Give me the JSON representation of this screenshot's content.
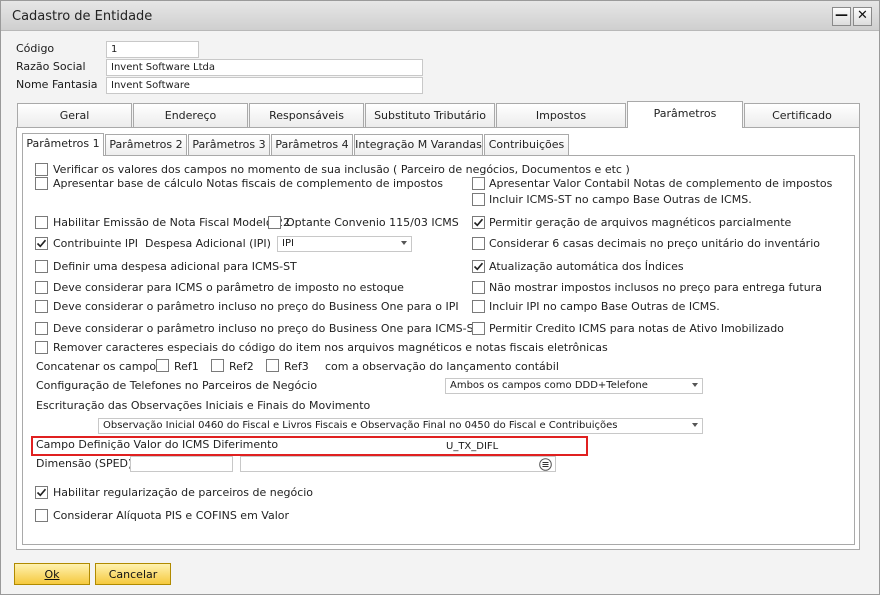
{
  "window": {
    "title": "Cadastro de Entidade",
    "minimize": "—",
    "close": "✕"
  },
  "header": {
    "codigo_label": "Código",
    "codigo_value": "1",
    "razao_label": "Razão Social",
    "razao_value": "Invent Software Ltda",
    "fantasia_label": "Nome Fantasia",
    "fantasia_value": "Invent Software"
  },
  "tabs": [
    "Geral",
    "Endereço",
    "Responsáveis",
    "Substituto Tributário",
    "Impostos",
    "Parâmetros",
    "Certificado"
  ],
  "active_tab": "Parâmetros",
  "subtabs": [
    "Parâmetros 1",
    "Parâmetros 2",
    "Parâmetros 3",
    "Parâmetros 4",
    "Integração M Varandas",
    "Contribuições"
  ],
  "active_subtab": "Parâmetros 1",
  "options": {
    "verificar": {
      "label": "Verificar os valores dos campos no momento de sua inclusão ( Parceiro de negócios, Documentos e etc )",
      "checked": false
    },
    "apresentar_base": {
      "label": "Apresentar base de cálculo Notas fiscais de complemento de impostos",
      "checked": false
    },
    "apresentar_valor": {
      "label": "Apresentar Valor Contabil Notas de complemento de impostos",
      "checked": false
    },
    "incluir_icms_st": {
      "label": "Incluir ICMS-ST no campo Base Outras de ICMS.",
      "checked": false
    },
    "habilitar_nf22": {
      "label": "Habilitar Emissão de Nota Fiscal Modelo 22",
      "checked": false
    },
    "optante": {
      "label": "Optante Convenio 115/03 ICMS",
      "checked": false
    },
    "permitir_magneticos": {
      "label": "Permitir geração de arquivos magnéticos parcialmente",
      "checked": true
    },
    "contribuinte_ipi": {
      "label": "Contribuinte IPI",
      "checked": true
    },
    "despesa_label": "Despesa Adicional (IPI)",
    "despesa_value": "IPI",
    "considerar_6casas": {
      "label": "Considerar 6 casas decimais no preço unitário do inventário",
      "checked": false
    },
    "definir_despesa": {
      "label": "Definir uma despesa adicional para ICMS-ST",
      "checked": false
    },
    "atualizacao_indices": {
      "label": "Atualização automática dos Índices",
      "checked": true
    },
    "icms_estoque": {
      "label": "Deve considerar para ICMS o parâmetro de imposto no estoque",
      "checked": false
    },
    "nao_mostrar": {
      "label": "Não mostrar impostos inclusos no preço para entrega futura",
      "checked": false
    },
    "param_ipi": {
      "label": "Deve considerar o parâmetro incluso no preço do Business One para o IPI",
      "checked": false
    },
    "incluir_ipi": {
      "label": "Incluir IPI no campo Base Outras de ICMS.",
      "checked": false
    },
    "param_icms_st": {
      "label": "Deve considerar o parâmetro incluso no preço do Business One para ICMS-ST",
      "checked": false
    },
    "credito_icms": {
      "label": "Permitir Credito ICMS para notas de Ativo Imobilizado",
      "checked": false
    },
    "remover_caracteres": {
      "label": "Remover caracteres especiais do código do item nos arquivos magnéticos e notas fiscais eletrônicas",
      "checked": false
    },
    "concatenar_label": "Concatenar os campos",
    "ref1": {
      "label": "Ref1",
      "checked": false
    },
    "ref2": {
      "label": "Ref2",
      "checked": false
    },
    "ref3": {
      "label": "Ref3",
      "checked": false
    },
    "concatenar_suffix": "com a observação do lançamento contábil",
    "telefones_label": "Configuração de Telefones no Parceiros de Negócio",
    "telefones_value": "Ambos os campos como DDD+Telefone",
    "escrituracao_label": "Escrituração das Observações Iniciais e Finais do Movimento",
    "escrituracao_value": "Observação Inicial 0460 do Fiscal e Livros Fiscais e Observação Final no 0450 do Fiscal e Contribuições",
    "icms_diferimento_label": "Campo Definição Valor do ICMS Diferimento",
    "icms_diferimento_value": "U_TX_DIFL",
    "dimensao_label": "Dimensão (SPED)",
    "dimensao_value": "",
    "habilitar_regularizacao": {
      "label": "Habilitar regularização de  parceiros de  negócio",
      "checked": true
    },
    "aliquota_pis": {
      "label": "Considerar Alíquota PIS e COFINS em Valor",
      "checked": false
    }
  },
  "buttons": {
    "ok": "Ok",
    "cancel": "Cancelar"
  }
}
